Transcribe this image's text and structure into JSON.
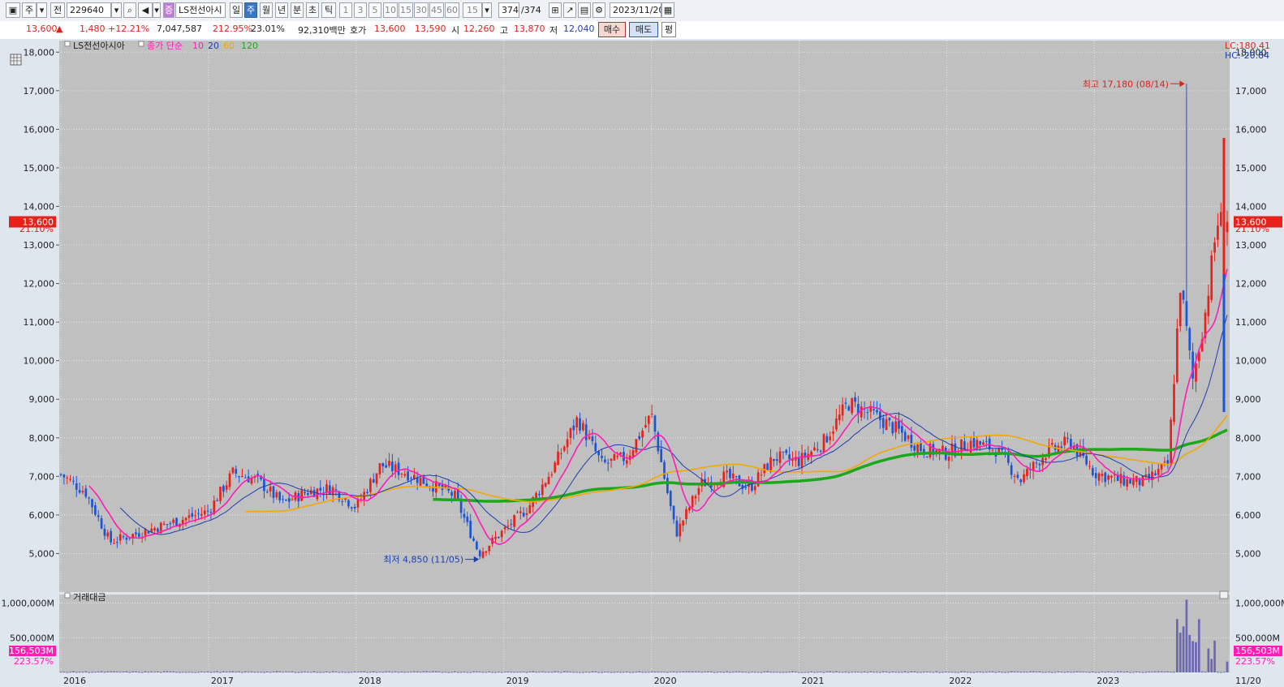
{
  "toolbar": {
    "mode_label": "주",
    "market_label": "전",
    "stock_code": "229640",
    "stock_name": "LS전선아시",
    "period_tabs": [
      "일",
      "주",
      "월",
      "년",
      "분",
      "초",
      "틱"
    ],
    "active_period": "주",
    "interval_buttons": [
      "1",
      "3",
      "5",
      "10",
      "15",
      "30",
      "45",
      "60"
    ],
    "interval_select": "15",
    "count_value": "374",
    "count_total": "/374",
    "date_value": "2023/11/20"
  },
  "quote": {
    "price": "13,600",
    "change": "1,480",
    "change_pct": "+12.21%",
    "volume": "7,047,587",
    "volume_ratio": "212.95%",
    "turnover_pct": "23.01%",
    "trade_value": "92,310백만",
    "bid_label": "호가",
    "ask_price": "13,600",
    "bid_price": "13,590",
    "open_label": "시",
    "open": "12,260",
    "high_label": "고",
    "high": "13,870",
    "low_label": "저",
    "low": "12,040",
    "buy_label": "매수",
    "sell_label": "매도",
    "eval_label": "평"
  },
  "legend": {
    "name": "LS전선아시아",
    "ma_prefix": "종가 단순",
    "ma_periods": [
      "10",
      "20",
      "60",
      "120"
    ],
    "volume_title": "거래대금"
  },
  "annotations": {
    "high": "최고 17,180 (08/14)",
    "low": "최저 4,850 (11/05)",
    "lc": "LC:180.41",
    "hc": "HC:-20.84",
    "price_tag": "13,600",
    "pct_tag": "21.10%",
    "vol_tag": "156,503M",
    "vol_pct_tag": "223.57%",
    "last_date": "11/20"
  },
  "colors": {
    "up": "#e8221a",
    "down": "#1b55d6",
    "ma10": "#ff1db8",
    "ma20": "#1b3fb0",
    "ma60": "#f2a800",
    "ma120": "#1ba81b",
    "volume": "#6a68b0",
    "plot_bg": "#c0c0c0"
  },
  "chart_data": {
    "type": "candlestick",
    "title": "LS전선아시아",
    "x_tick_labels": [
      "2016",
      "2017",
      "2018",
      "2019",
      "2020",
      "2021",
      "2022",
      "2023"
    ],
    "y_tick_labels": [
      "5,000",
      "6,000",
      "7,000",
      "8,000",
      "9,000",
      "10,000",
      "11,000",
      "12,000",
      "13,000",
      "14,000",
      "15,000",
      "16,000",
      "17,000",
      "18,000"
    ],
    "ylim": [
      4000,
      18300
    ],
    "volume_tick_labels": [
      "500,000M",
      "1,000,000M"
    ],
    "volume_ylim": [
      0,
      1100000
    ],
    "grid": true,
    "current_price": 13600,
    "period_high": {
      "value": 17180,
      "date": "08/14"
    },
    "period_low": {
      "value": 4850,
      "date": "11/05"
    },
    "close_series": [
      {
        "date": "2016-01",
        "close": 7050
      },
      {
        "date": "2016-03",
        "close": 6600
      },
      {
        "date": "2016-05",
        "close": 5300
      },
      {
        "date": "2016-07",
        "close": 5500
      },
      {
        "date": "2016-09",
        "close": 5700
      },
      {
        "date": "2016-11",
        "close": 5900
      },
      {
        "date": "2017-01",
        "close": 6100
      },
      {
        "date": "2017-03",
        "close": 7100
      },
      {
        "date": "2017-05",
        "close": 6900
      },
      {
        "date": "2017-07",
        "close": 6300
      },
      {
        "date": "2017-09",
        "close": 6600
      },
      {
        "date": "2017-11",
        "close": 6700
      },
      {
        "date": "2018-01",
        "close": 6200
      },
      {
        "date": "2018-03",
        "close": 7300
      },
      {
        "date": "2018-05",
        "close": 7100
      },
      {
        "date": "2018-07",
        "close": 6800
      },
      {
        "date": "2018-09",
        "close": 6500
      },
      {
        "date": "2018-11",
        "close": 5000
      },
      {
        "date": "2019-01",
        "close": 5600
      },
      {
        "date": "2019-03",
        "close": 6200
      },
      {
        "date": "2019-05",
        "close": 7200
      },
      {
        "date": "2019-07",
        "close": 8500
      },
      {
        "date": "2019-09",
        "close": 7300
      },
      {
        "date": "2019-11",
        "close": 7500
      },
      {
        "date": "2020-01",
        "close": 8600
      },
      {
        "date": "2020-03",
        "close": 5500
      },
      {
        "date": "2020-05",
        "close": 6800
      },
      {
        "date": "2020-07",
        "close": 7000
      },
      {
        "date": "2020-09",
        "close": 6700
      },
      {
        "date": "2020-11",
        "close": 7500
      },
      {
        "date": "2021-01",
        "close": 7400
      },
      {
        "date": "2021-03",
        "close": 7900
      },
      {
        "date": "2021-05",
        "close": 8900
      },
      {
        "date": "2021-07",
        "close": 8600
      },
      {
        "date": "2021-09",
        "close": 8200
      },
      {
        "date": "2021-11",
        "close": 7700
      },
      {
        "date": "2022-01",
        "close": 7600
      },
      {
        "date": "2022-03",
        "close": 7900
      },
      {
        "date": "2022-05",
        "close": 7700
      },
      {
        "date": "2022-07",
        "close": 6900
      },
      {
        "date": "2022-09",
        "close": 7600
      },
      {
        "date": "2022-11",
        "close": 7900
      },
      {
        "date": "2023-01",
        "close": 7100
      },
      {
        "date": "2023-03",
        "close": 6900
      },
      {
        "date": "2023-05",
        "close": 6850
      },
      {
        "date": "2023-07",
        "close": 7300
      },
      {
        "date": "2023-08",
        "close": 12000
      },
      {
        "date": "2023-09",
        "close": 9500
      },
      {
        "date": "2023-10",
        "close": 11200
      },
      {
        "date": "2023-11",
        "close": 13600
      }
    ],
    "series": [
      {
        "name": "10",
        "type": "ma"
      },
      {
        "name": "20",
        "type": "ma"
      },
      {
        "name": "60",
        "type": "ma"
      },
      {
        "name": "120",
        "type": "ma"
      }
    ],
    "volume_notes": "trade value bars; peak approx 1,050,000M in 2023-08"
  }
}
